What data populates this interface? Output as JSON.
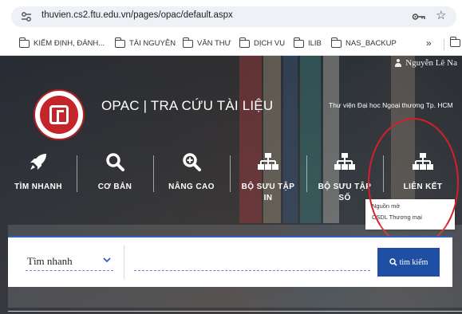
{
  "browser": {
    "url": "thuvien.cs2.ftu.edu.vn/pages/opac/default.aspx"
  },
  "bookmarks": {
    "items": [
      "KIỂM ĐỊNH, ĐÁNH...",
      "TÀI NGUYÊN",
      "VĂN THƯ",
      "DỊCH VỤ",
      "ILIB",
      "NAS_BACKUP"
    ],
    "more": "»"
  },
  "header": {
    "user_name": "Nguyễn Lê Na",
    "title": "OPAC | TRA CỨU TÀI LIỆU",
    "university": "Thư viện Đại học Ngoại thương Tp. HCM"
  },
  "nav": {
    "items": [
      {
        "label": "TÌM NHANH",
        "icon": "rocket-icon"
      },
      {
        "label": "CƠ BẢN",
        "icon": "search-icon"
      },
      {
        "label": "NÂNG CAO",
        "icon": "zoom-plus-icon"
      },
      {
        "label": "BỘ SƯU TẬP IN",
        "icon": "sitemap-icon"
      },
      {
        "label": "BỘ SƯU TẬP SỐ",
        "icon": "sitemap-icon"
      },
      {
        "label": "LIÊN KẾT",
        "icon": "sitemap-icon"
      }
    ],
    "dropdown": [
      "Nguồn mở",
      "CSDL Thương mại"
    ]
  },
  "search": {
    "type_selected": "Tìm nhanh",
    "query": "",
    "button_label": "tìm kiếm"
  },
  "colors": {
    "accent_blue": "#1f4fa3",
    "highlight_red": "#d4202a",
    "logo_red": "#c4252a"
  }
}
